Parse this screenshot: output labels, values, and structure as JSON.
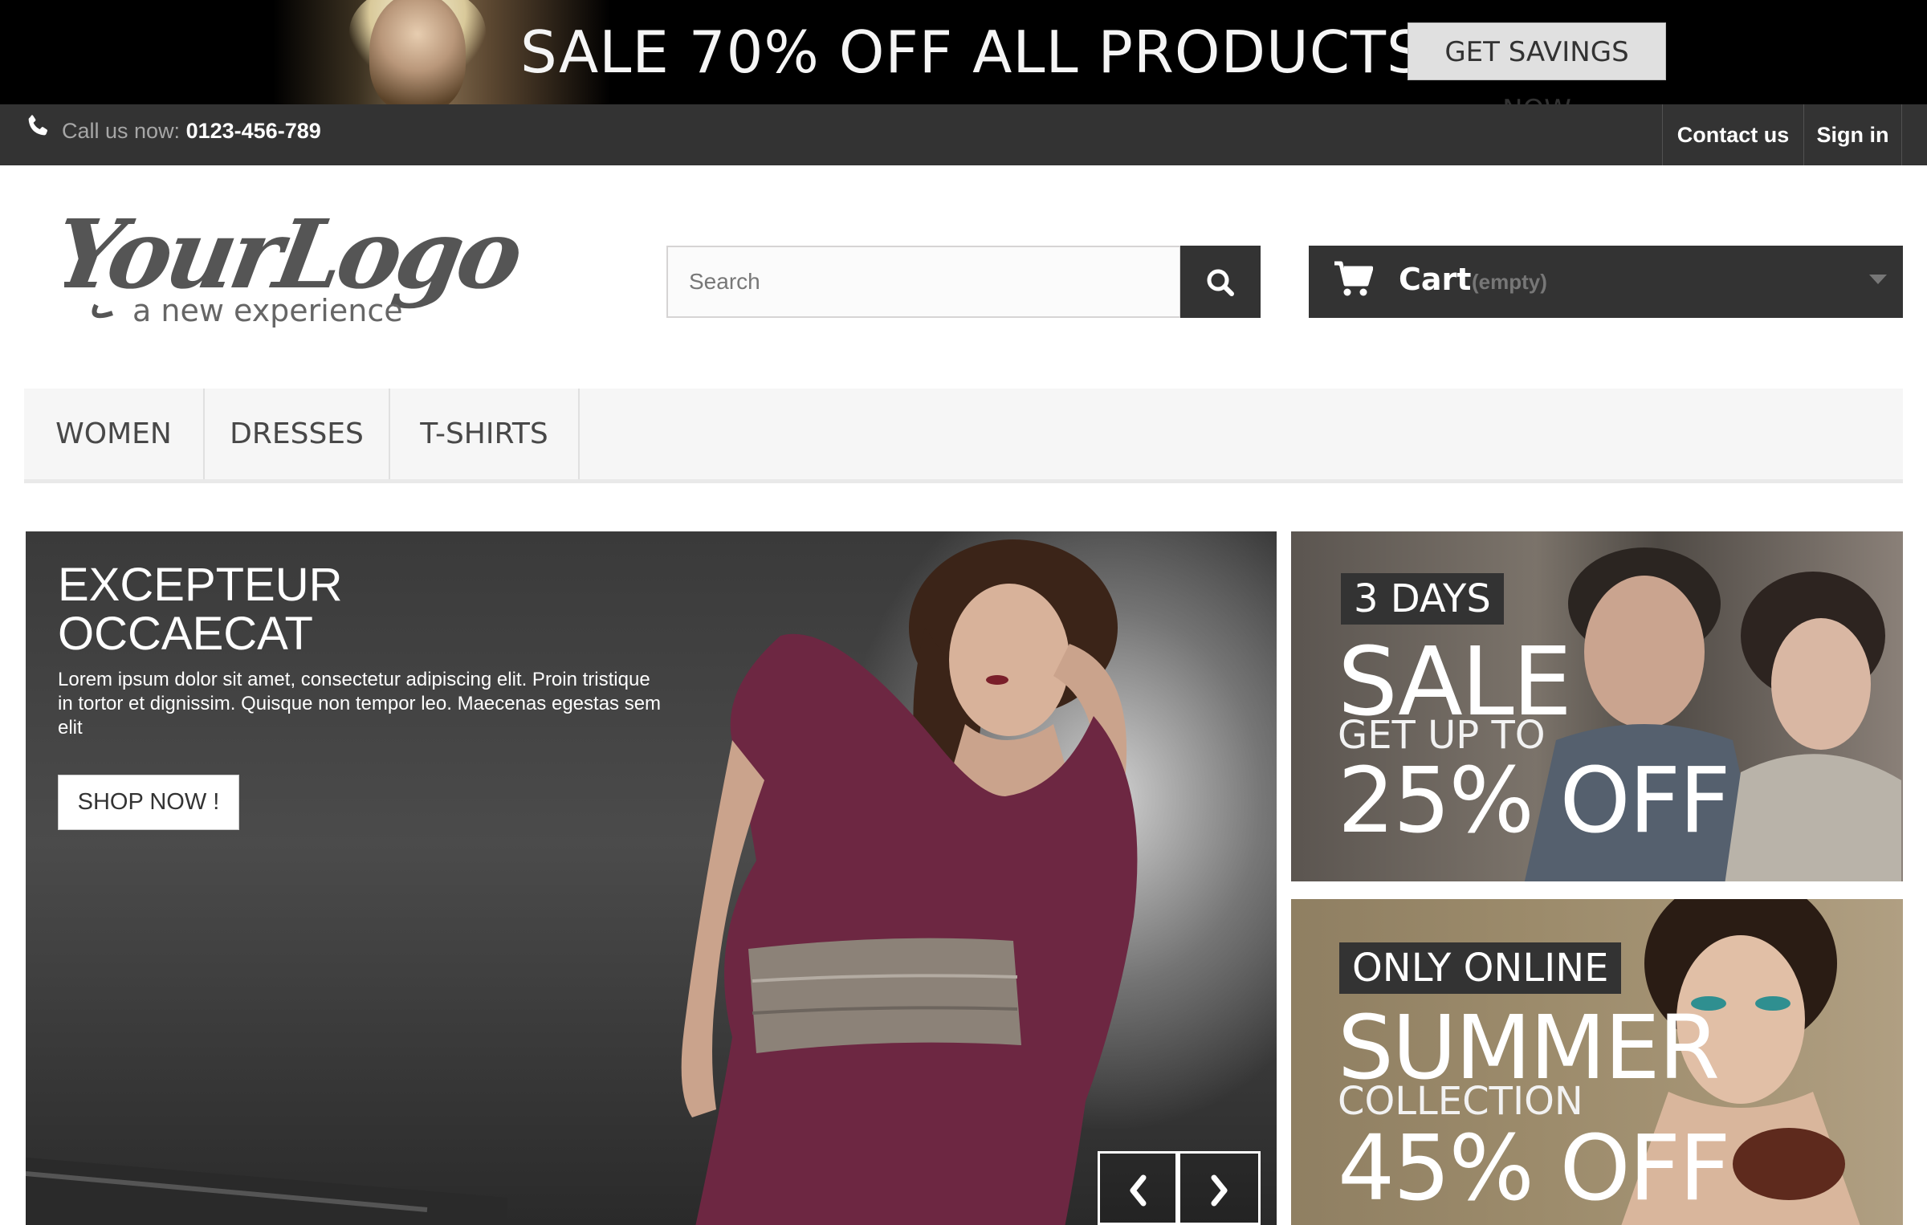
{
  "promo": {
    "text": "SALE 70% OFF ALL PRODUCTS",
    "button": "GET SAVINGS NOW"
  },
  "nav": {
    "call_label": "Call us now:",
    "phone": "0123-456-789",
    "contact": "Contact us",
    "signin": "Sign in"
  },
  "logo": {
    "main": "YourLogo",
    "tagline": "a new experience"
  },
  "search": {
    "placeholder": "Search"
  },
  "cart": {
    "label": "Cart",
    "status": "(empty)"
  },
  "menu": [
    {
      "label": "WOMEN"
    },
    {
      "label": "DRESSES"
    },
    {
      "label": "T-SHIRTS"
    }
  ],
  "hero": {
    "title_line1": "EXCEPTEUR",
    "title_line2": "OCCAECAT",
    "text": "Lorem ipsum dolor sit amet, consectetur adipiscing elit. Proin tristique in tortor et dignissim. Quisque non tempor leo. Maecenas egestas sem elit",
    "button": "SHOP NOW !"
  },
  "banners": [
    {
      "tag": "3 DAYS",
      "big": "SALE",
      "sub": "GET UP TO",
      "offer": "25% OFF"
    },
    {
      "tag": "ONLY ONLINE",
      "big": "SUMMER",
      "sub": "COLLECTION",
      "offer": "45% OFF"
    }
  ],
  "colors": {
    "dark": "#333333",
    "promo_bg": "#000000",
    "menu_bg": "#f6f6f6"
  }
}
